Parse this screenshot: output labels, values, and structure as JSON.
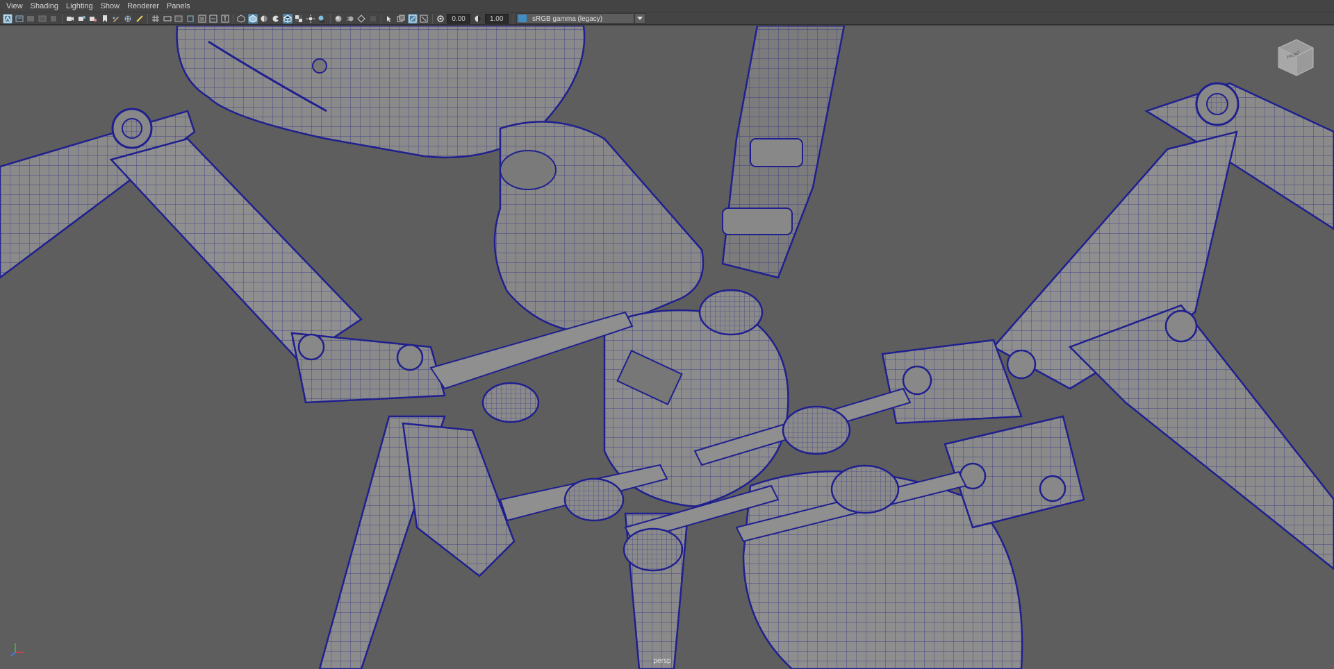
{
  "menubar": {
    "items": [
      "View",
      "Shading",
      "Lighting",
      "Show",
      "Renderer",
      "Panels"
    ]
  },
  "toolbar": {
    "icons": [
      "select-camera-icon",
      "camera-attributes-icon",
      "bookmarks-icon",
      "image-plane-icon",
      "2d-pan-zoom-icon",
      "camera-icon",
      "lock-camera-icon",
      "camera-bookmark-icon",
      "bookmark-icon",
      "grease-pencil-icon",
      "film-gate-icon",
      "resolution-gate-icon",
      "grid-icon",
      "field-chart-icon",
      "safe-action-icon",
      "safe-title-icon",
      "gate-mask-icon",
      "uv-editor-icon",
      "text-icon",
      "wireframe-icon",
      "smooth-shade-icon",
      "use-default-material-icon",
      "wireframe-on-shaded-icon",
      "xray-icon",
      "textured-icon",
      "lights-icon",
      "shadows-icon",
      "ambient-occlusion-icon",
      "motion-blur-icon",
      "anti-aliasing-icon",
      "depth-of-field-icon",
      "isolate-select-icon",
      "xray-joints-icon",
      "exposure-icon",
      "gamma-icon",
      "view-transform-icon"
    ],
    "exposure_value": "0.00",
    "gamma_value": "1.00",
    "color_space": "sRGB gamma (legacy)"
  },
  "viewport": {
    "camera_label": "persp",
    "viewcube_face": "FRONT",
    "background_color": "#5e5e5e",
    "wire_color": "#1f1f8f",
    "surface_color": "#8a8a8a"
  }
}
